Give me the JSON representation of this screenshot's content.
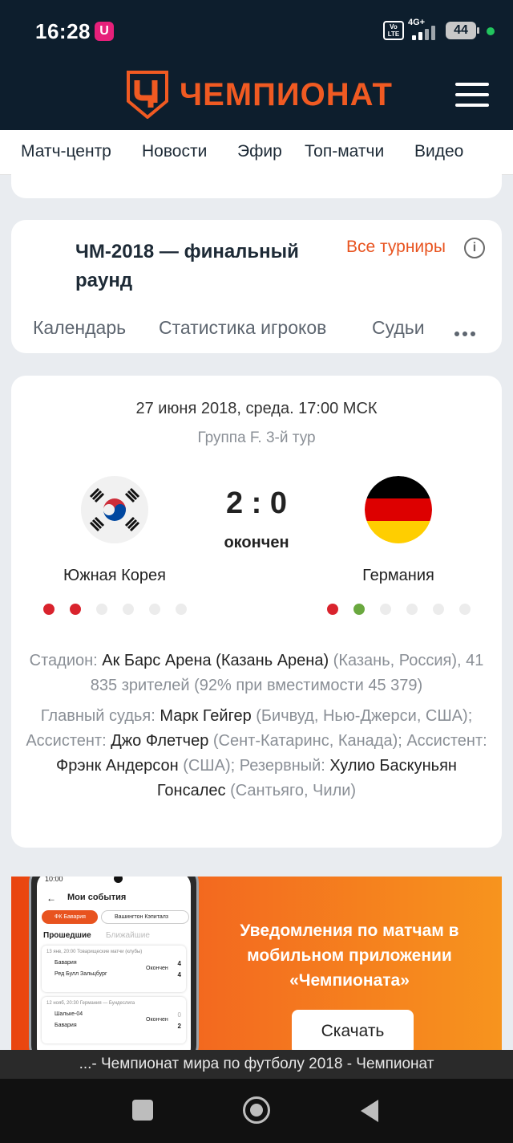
{
  "status_bar": {
    "time": "16:28",
    "app_icon": "U",
    "volte": "Vo LTE",
    "network": "4G+",
    "battery": "44"
  },
  "header": {
    "logo_text": "ЧЕМПИОНАТ",
    "brand_color": "#f05a22"
  },
  "nav": {
    "items": [
      "Матч-центр",
      "Новости",
      "Эфир",
      "Топ-матчи",
      "Видео"
    ]
  },
  "tournament": {
    "title": "ЧМ-2018 — финальный раунд",
    "all_link": "Все турниры",
    "tabs": [
      "Календарь",
      "Статистика игроков",
      "Судьи"
    ]
  },
  "match": {
    "date": "27 июня 2018, среда. 17:00 МСК",
    "group": "Группа F. 3-й тур",
    "score": "2 : 0",
    "status": "окончен",
    "home_team": "Южная Корея",
    "away_team": "Германия",
    "home_form": [
      "red",
      "red",
      "empty",
      "empty",
      "empty",
      "empty"
    ],
    "away_form": [
      "red",
      "green",
      "empty",
      "empty",
      "empty",
      "empty"
    ],
    "stadium_label": "Стадион:",
    "stadium_name": "Ак Барс Арена (Казань Арена)",
    "stadium_place": "(Казань, Россия), 41 835 зрителей (92% при вместимости 45 379)",
    "referee_label": "Главный судья:",
    "referee_name": "Марк Гейгер",
    "referee_place": "(Бичвуд, Нью-Джерси, США);",
    "assistant1_label": "Ассистент:",
    "assistant1_name": "Джо Флетчер",
    "assistant1_place": "(Сент-Катаринс, Канада);",
    "assistant2_label": "Ассистент:",
    "assistant2_name": "Фрэнк Андерсон",
    "assistant2_place": "(США); Резервный:",
    "reserve_name": "Хулио Баскуньян Гонсалес",
    "reserve_place": "(Сантьяго, Чили)"
  },
  "promo": {
    "headline": "Уведомления по матчам в мобильном приложении «Чемпионата»",
    "download_button": "Скачать",
    "phone": {
      "time": "10:00",
      "title": "Мои события",
      "chip1": "ФК Бавария",
      "chip2": "Вашингтон Кэпиталз",
      "tab_past": "Прошедшие",
      "tab_upcoming": "Ближайшие",
      "m1_meta": "13 янв, 20:00  Товарищеские матчи (клубы)",
      "m1_team1": "Бавария",
      "m1_team2": "Ред Булл Зальцбург",
      "m1_status": "Окончен",
      "m1_score1": "4",
      "m1_score2": "4",
      "m2_meta": "12 нояб, 20:30  Германия — Бундеслига",
      "m2_team1": "Шальке-04",
      "m2_team2": "Бавария",
      "m2_status": "Окончен",
      "m2_score1": "0",
      "m2_score2": "2"
    }
  },
  "browser": {
    "page_title": "...- Чемпионат мира по футболу 2018 - Чемпионат"
  },
  "colors": {
    "header_bg": "#0d1e2d",
    "form_red": "#d9232d",
    "form_green": "#6aa83f",
    "form_empty": "#ececec"
  }
}
